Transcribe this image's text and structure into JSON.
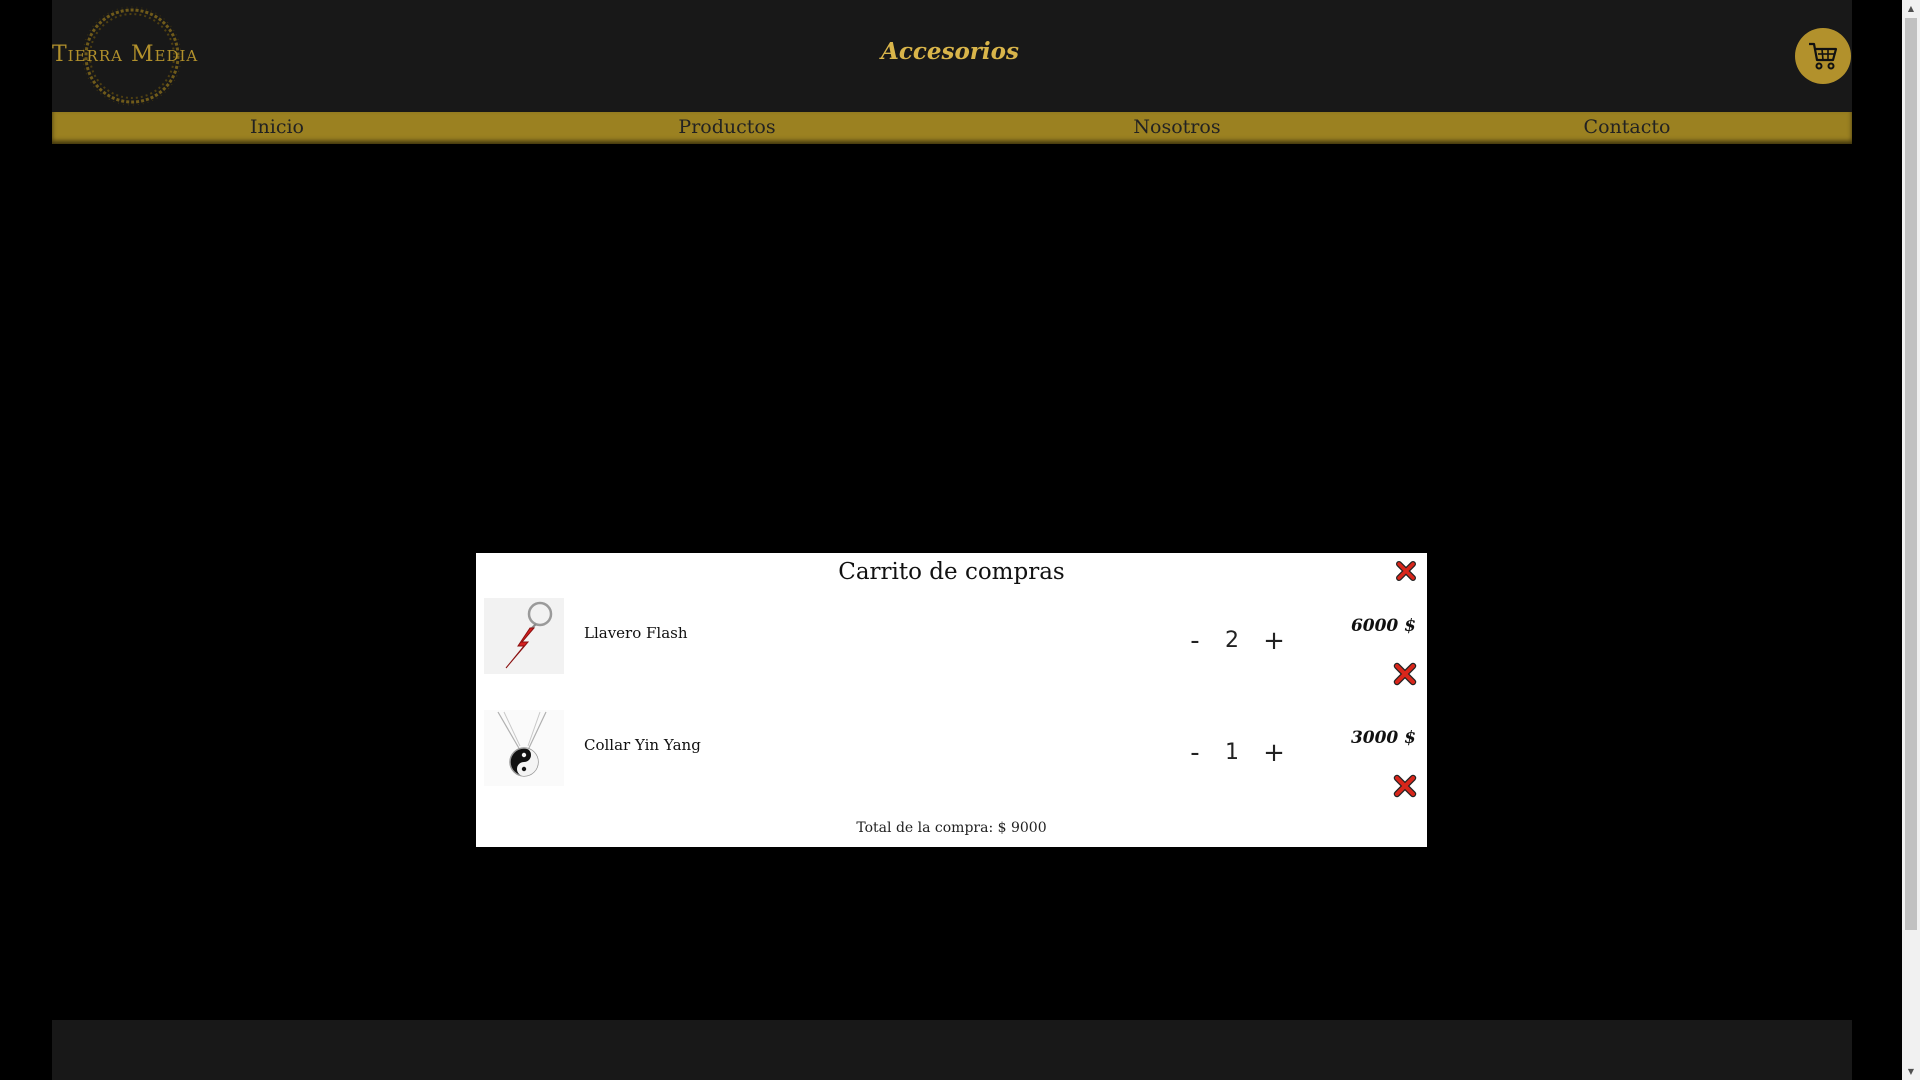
{
  "header": {
    "logo_text": "Tierra Media",
    "title": "Accesorios",
    "cart_icon": "cart-icon"
  },
  "nav": {
    "items": [
      {
        "label": "Inicio"
      },
      {
        "label": "Productos"
      },
      {
        "label": "Nosotros"
      },
      {
        "label": "Contacto"
      }
    ]
  },
  "cart_modal": {
    "title": "Carrito de compras",
    "close_icon": "close-icon",
    "items": [
      {
        "name": "Llavero Flash",
        "quantity": "2",
        "price": "6000 $",
        "minus": "-",
        "plus": "+",
        "image": "keychain-lightning-image"
      },
      {
        "name": "Collar Yin Yang",
        "quantity": "1",
        "price": "3000 $",
        "minus": "-",
        "plus": "+",
        "image": "yin-yang-necklace-image"
      }
    ],
    "total_label": "Total de la compra: $ 9000"
  },
  "colors": {
    "header_bg": "#181818",
    "accent_gold": "#b2912c",
    "nav_bg": "#9b8121",
    "title_gold": "#d9b54a",
    "remove_red": "#d8261b"
  }
}
